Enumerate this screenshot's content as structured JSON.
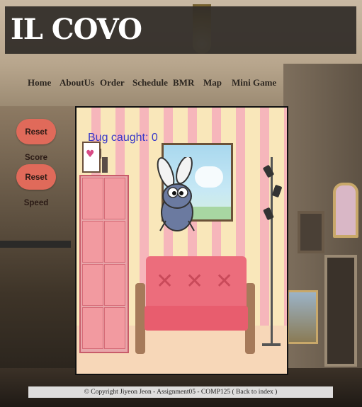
{
  "header": {
    "logo": "IL COVO"
  },
  "nav": {
    "items": [
      "Home",
      "AboutUs",
      "Order",
      "Schedule",
      "BMR",
      "Map",
      "Mini Game"
    ]
  },
  "controls": {
    "reset_score": "Reset Score",
    "reset_speed": "Reset Speed"
  },
  "game": {
    "score_text": "Bug caught: 0"
  },
  "footer": {
    "copyright": "© Copyright Jiyeon Jeon - Assignment05 - COMP125 (",
    "back_link": "Back to index",
    "close": ")"
  },
  "colors": {
    "button": "#e06a5a",
    "score": "#3a39c8",
    "header_bg": "#302c28"
  },
  "icons": [
    "heart-icon",
    "bug-sprite",
    "floor-lamp"
  ]
}
